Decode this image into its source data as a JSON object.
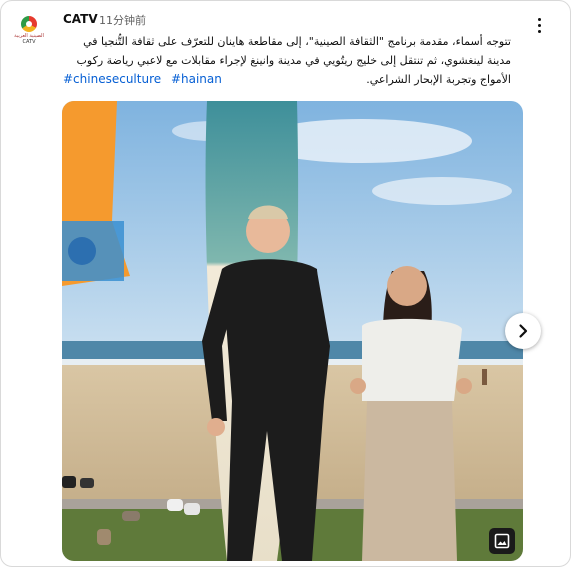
{
  "post": {
    "channel_name": "CATV",
    "time_ago": "11分钟前",
    "avatar_text": "الصينية العربية",
    "avatar_sub": "CATV",
    "text": "تتوجه أسماء، مقدمة برنامج \"الثقافة الصينية\"، إلى مقاطعة هاينان للتعرّف على ثقافة التُّنجيا في مدينة لينغشوي، ثم تنتقل إلى خليج ريتُويي في مدينة وانينغ لإجراء مقابلات مع لاعبي رياضة ركوب الأمواج وتجربة الإبحار الشراعي.",
    "hashtags": [
      "#chineseculture",
      "#hainan"
    ]
  },
  "icons": {
    "menu": "more-vert-icon",
    "next": "chevron-right-icon",
    "gallery": "image-gallery-icon"
  },
  "colors": {
    "link": "#065fd4",
    "text": "#0f0f0f",
    "muted": "#606060"
  }
}
